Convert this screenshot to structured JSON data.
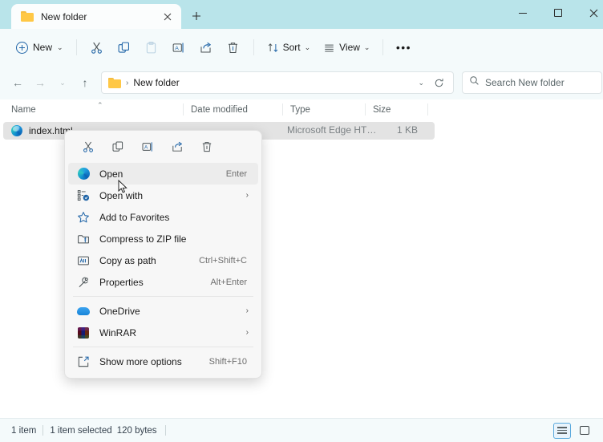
{
  "titlebar": {
    "tab_label": "New folder",
    "tab_close_icon": "close-icon",
    "new_tab_icon": "plus-icon",
    "minimize_icon": "minimize-icon",
    "maximize_icon": "maximize-icon",
    "close_icon": "close-icon"
  },
  "toolbar": {
    "new_label": "New",
    "new_chevron": "⌄",
    "cut_icon": "cut-icon",
    "copy_icon": "copy-icon",
    "paste_icon": "paste-icon",
    "rename_icon": "rename-icon",
    "share_icon": "share-icon",
    "delete_icon": "delete-icon",
    "sort_label": "Sort",
    "view_label": "View",
    "more_label": "•••"
  },
  "addressbar": {
    "back_icon": "←",
    "forward_icon": "→",
    "recent_icon": "⌄",
    "up_icon": "↑",
    "separator": "›",
    "crumb": "New folder",
    "dropdown_icon": "⌄",
    "refresh_icon": "refresh-icon"
  },
  "search": {
    "placeholder": "Search New folder",
    "value": "",
    "icon": "search-icon"
  },
  "columns": [
    {
      "label": "Name",
      "sort_caret": "⌃"
    },
    {
      "label": "Date modified"
    },
    {
      "label": "Type"
    },
    {
      "label": "Size"
    }
  ],
  "files": [
    {
      "name": "index.html",
      "icon": "edge-browser-icon",
      "date_modified": "",
      "type": "Microsoft Edge HT…",
      "size": "1 KB"
    }
  ],
  "context_menu": {
    "icon_row": [
      {
        "name": "cut-icon"
      },
      {
        "name": "copy-icon"
      },
      {
        "name": "rename-icon"
      },
      {
        "name": "share-icon"
      },
      {
        "name": "delete-icon"
      }
    ],
    "items": [
      {
        "label": "Open",
        "accel": "Enter",
        "icon": "edge-browser-icon",
        "selected": true,
        "submenu": false
      },
      {
        "label": "Open with",
        "accel": "",
        "icon": "open-with-icon",
        "selected": false,
        "submenu": true
      },
      {
        "label": "Add to Favorites",
        "accel": "",
        "icon": "star-icon",
        "selected": false,
        "submenu": false
      },
      {
        "label": "Compress to ZIP file",
        "accel": "",
        "icon": "zip-folder-icon",
        "selected": false,
        "submenu": false
      },
      {
        "label": "Copy as path",
        "accel": "Ctrl+Shift+C",
        "icon": "copy-path-icon",
        "selected": false,
        "submenu": false
      },
      {
        "label": "Properties",
        "accel": "Alt+Enter",
        "icon": "wrench-icon",
        "selected": false,
        "submenu": false
      },
      {
        "label": "OneDrive",
        "accel": "",
        "icon": "onedrive-icon",
        "selected": false,
        "submenu": true
      },
      {
        "label": "WinRAR",
        "accel": "",
        "icon": "winrar-icon",
        "selected": false,
        "submenu": true
      },
      {
        "label": "Show more options",
        "accel": "Shift+F10",
        "icon": "show-more-icon",
        "selected": false,
        "submenu": false
      }
    ],
    "submenu_arrow": "›"
  },
  "statusbar": {
    "item_count": "1 item",
    "selection": "1 item selected",
    "bytes": "120 bytes",
    "details_view_icon": "details-view-icon",
    "large_icons_view_icon": "large-icons-view-icon"
  }
}
